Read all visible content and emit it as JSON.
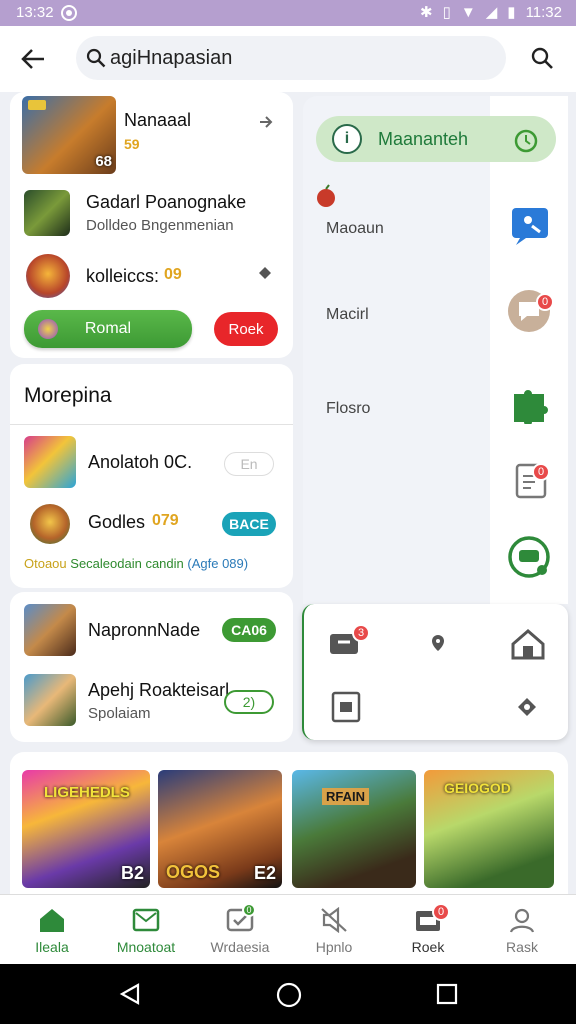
{
  "status": {
    "time": "13:32",
    "right_time": "11:32"
  },
  "search": {
    "value": "agiHnapasian"
  },
  "top_card": {
    "game1": {
      "title": "Nanaaal",
      "badge": "68",
      "points": "59"
    },
    "game2": {
      "title": "Gadarl Poanognake",
      "subtitle": "Dolldeo Bngenmenian"
    },
    "game3": {
      "title": "kolleiccs:",
      "coins": "09"
    },
    "green_button": "Romal",
    "red_button": "Roek"
  },
  "section": {
    "title": "Morepina",
    "rows": [
      {
        "title": "Anolatoh 0C.",
        "action": "En"
      },
      {
        "title": "Godles",
        "coins": "079",
        "action": "BACE"
      }
    ],
    "promo": {
      "prefix": "Otoaou",
      "main": "Secaleodain candin",
      "suffix": "(Agfe 089)"
    }
  },
  "card3": {
    "rows": [
      {
        "title": "NapronnNade",
        "action": "CA06"
      },
      {
        "title": "Apehj Roakteisarl",
        "subtitle": "Spolaiam",
        "action": "2)"
      }
    ]
  },
  "drawer": {
    "active_item": "Maananteh",
    "items": [
      "Maoaun",
      "Macirl",
      "Flosro"
    ],
    "badges": {
      "chat": "0",
      "doc": "0",
      "grid": "3"
    }
  },
  "banners": {
    "b1": "LIGEHEDLS",
    "b2_text": "OGOS",
    "b2_corner": "E2",
    "b1_corner": "B2",
    "b3_text": "RFAIN",
    "b4_text": "GEIOGOD"
  },
  "nav": [
    {
      "label": "Ileala",
      "active": true
    },
    {
      "label": "Mnoatoat",
      "active": false
    },
    {
      "label": "Wrdaesia",
      "active": false,
      "badge": "0"
    },
    {
      "label": "Hpnlo",
      "active": false
    },
    {
      "label": "Roek",
      "active": false,
      "badge": "0"
    },
    {
      "label": "Rask",
      "active": false
    }
  ],
  "colors": {
    "green": "#3d9a34",
    "red": "#e8262a",
    "teal": "#1aa3b8",
    "status_bar": "#b59fcf"
  }
}
